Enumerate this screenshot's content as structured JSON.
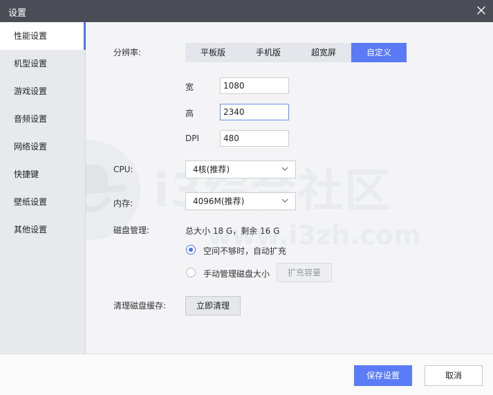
{
  "window": {
    "title": "设置"
  },
  "sidebar": {
    "items": [
      {
        "label": "性能设置"
      },
      {
        "label": "机型设置"
      },
      {
        "label": "游戏设置"
      },
      {
        "label": "音频设置"
      },
      {
        "label": "网络设置"
      },
      {
        "label": "快捷键"
      },
      {
        "label": "壁纸设置"
      },
      {
        "label": "其他设置"
      }
    ]
  },
  "performance": {
    "resolution_label": "分辨率:",
    "resolution_options": [
      "平板版",
      "手机版",
      "超宽屏",
      "自定义"
    ],
    "resolution_selected": "自定义",
    "width_label": "宽",
    "width_value": "1080",
    "height_label": "高",
    "height_value": "2340",
    "dpi_label": "DPI",
    "dpi_value": "480",
    "cpu_label": "CPU:",
    "cpu_value": "4核(推荐)",
    "memory_label": "内存:",
    "memory_value": "4096M(推荐)",
    "disk_label": "磁盘管理:",
    "disk_summary": "总大小 18 G，剩余 16 G",
    "disk_options": [
      {
        "label": "空间不够时，自动扩充",
        "selected": true
      },
      {
        "label": "手动管理磁盘大小",
        "selected": false
      }
    ],
    "expand_button": "扩充容量",
    "cache_label": "清理磁盘缓存:",
    "cache_button": "立即清理"
  },
  "footer": {
    "save_label": "保存设置",
    "cancel_label": "取消"
  },
  "watermark": {
    "text_cn": "i3综合社区",
    "text_url": "www.i3zh.com"
  },
  "colors": {
    "accent": "#5b7cf6",
    "titlebar": "#4a4d56"
  }
}
